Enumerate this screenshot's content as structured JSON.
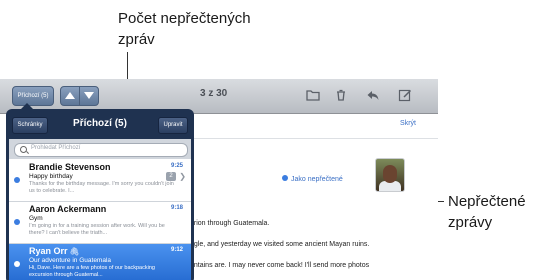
{
  "callouts": {
    "unread_count": "Počet nepřečtených\nzpráv",
    "unread_messages": "Nepřečtené\nzprávy"
  },
  "toolbar": {
    "inbox_button": "Příchozí (5)",
    "counter": "3 z 30",
    "icons": [
      "folder-icon",
      "trash-icon",
      "reply-icon",
      "compose-icon"
    ]
  },
  "popover": {
    "mailboxes_button": "Schránky",
    "title": "Příchozí (5)",
    "edit_button": "Upravit",
    "search_placeholder": "Prohledat Příchozí"
  },
  "messages": [
    {
      "sender": "Brandie Stevenson",
      "time": "9:25",
      "subject": "Happy birthday",
      "preview": "Thanks for the birthday message. I'm sorry you couldn't join us to celebrate. I...",
      "unread": true,
      "thread_count": "2",
      "selected": false
    },
    {
      "sender": "Aaron Ackermann",
      "time": "9:18",
      "subject": "Gym",
      "preview": "I'm going in for a training session after work. Will you be there? I can't believe the triath...",
      "unread": true,
      "selected": false
    },
    {
      "sender": "Ryan Orr",
      "time": "9:12",
      "subject": "Our adventure in Guatemala",
      "preview": "Hi, Dave. Here are a few photos of our backpacking excursion through Guatemal...",
      "unread": true,
      "selected": true
    }
  ],
  "message_view": {
    "hide_link": "Skrýt",
    "mark_unread": "Jako nepřečtené",
    "body_lines": [
      "urion through Guatemala.",
      "ngle, and yesterday we visited some ancient Mayan ruins.",
      "untains are. I may never come back! I'll send more photos"
    ]
  },
  "colors": {
    "toolbar": "#c7cbd1",
    "popover": "#1f3250",
    "selected_row": "#2f79dd",
    "link": "#3a6fc5",
    "unread_dot": "#3b7de0"
  }
}
